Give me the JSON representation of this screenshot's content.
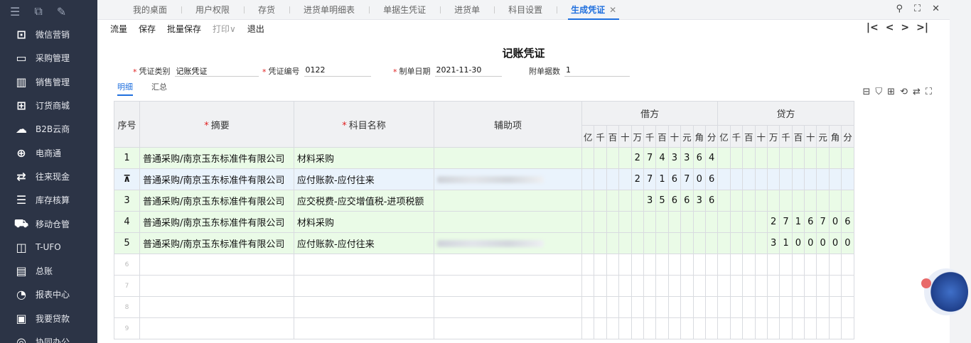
{
  "sidebar": {
    "items": [
      {
        "label": "微信营销",
        "icon": "wechat-icon"
      },
      {
        "label": "采购管理",
        "icon": "purchase-icon"
      },
      {
        "label": "销售管理",
        "icon": "sales-chart-icon"
      },
      {
        "label": "订货商城",
        "icon": "mall-icon"
      },
      {
        "label": "B2B云商",
        "icon": "b2b-icon"
      },
      {
        "label": "电商通",
        "icon": "ecommerce-icon"
      },
      {
        "label": "往来现金",
        "icon": "cash-transfer-icon"
      },
      {
        "label": "库存核算",
        "icon": "inventory-icon"
      },
      {
        "label": "移动仓管",
        "icon": "mobile-warehouse-icon"
      },
      {
        "label": "T-UFO",
        "icon": "ufo-icon"
      },
      {
        "label": "总账",
        "icon": "ledger-icon"
      },
      {
        "label": "报表中心",
        "icon": "report-pie-icon"
      },
      {
        "label": "我要贷款",
        "icon": "loan-icon"
      },
      {
        "label": "协同办公",
        "icon": "collab-icon"
      }
    ]
  },
  "tabs": [
    {
      "label": "我的桌面"
    },
    {
      "label": "用户权限"
    },
    {
      "label": "存货"
    },
    {
      "label": "进货单明细表"
    },
    {
      "label": "单据生凭证"
    },
    {
      "label": "进货单"
    },
    {
      "label": "科目设置"
    },
    {
      "label": "生成凭证",
      "active": true
    }
  ],
  "toolbar": {
    "flow": "流量",
    "save": "保存",
    "batch_save": "批量保存",
    "print": "打印∨",
    "exit": "退出"
  },
  "voucher": {
    "title": "记账凭证",
    "type_label": "凭证类别",
    "type_value": "记账凭证",
    "number_label": "凭证编号",
    "number_value": "0122",
    "date_label": "制单日期",
    "date_value": "2021-11-30",
    "attach_label": "附单据数",
    "attach_value": "1"
  },
  "subtabs": {
    "detail": "明细",
    "summary": "汇总"
  },
  "table": {
    "headers": {
      "seq": "序号",
      "summary": "摘要",
      "account": "科目名称",
      "aux": "辅助项",
      "debit": "借方",
      "credit": "贷方",
      "required_mark": "*"
    },
    "digit_units": [
      "亿",
      "千",
      "百",
      "十",
      "万",
      "千",
      "百",
      "十",
      "元",
      "角",
      "分"
    ],
    "rows": [
      {
        "seq": "1",
        "summary": "普通采购/南京玉东标准件有限公司",
        "account": "材料采购",
        "debit": "274336 4",
        "credit": ""
      },
      {
        "seq": "",
        "summary": "普通采购/南京玉东标准件有限公司",
        "account": "应付账款-应付往来",
        "debit": "271670 6",
        "credit": ""
      },
      {
        "seq": "3",
        "summary": "普通采购/南京玉东标准件有限公司",
        "account": "应交税费-应交增值税-进项税额",
        "debit": "35663 6",
        "credit": ""
      },
      {
        "seq": "4",
        "summary": "普通采购/南京玉东标准件有限公司",
        "account": "材料采购",
        "debit": "",
        "credit": "271670 6"
      },
      {
        "seq": "5",
        "summary": "普通采购/南京玉东标准件有限公司",
        "account": "应付账款-应付往来",
        "debit": "",
        "credit": "310000 0"
      },
      {
        "seq": "6",
        "summary": "",
        "account": "",
        "debit": "",
        "credit": ""
      },
      {
        "seq": "7",
        "summary": "",
        "account": "",
        "debit": "",
        "credit": ""
      },
      {
        "seq": "8",
        "summary": "",
        "account": "",
        "debit": "",
        "credit": ""
      },
      {
        "seq": "9",
        "summary": "",
        "account": "",
        "debit": "",
        "credit": ""
      }
    ]
  }
}
